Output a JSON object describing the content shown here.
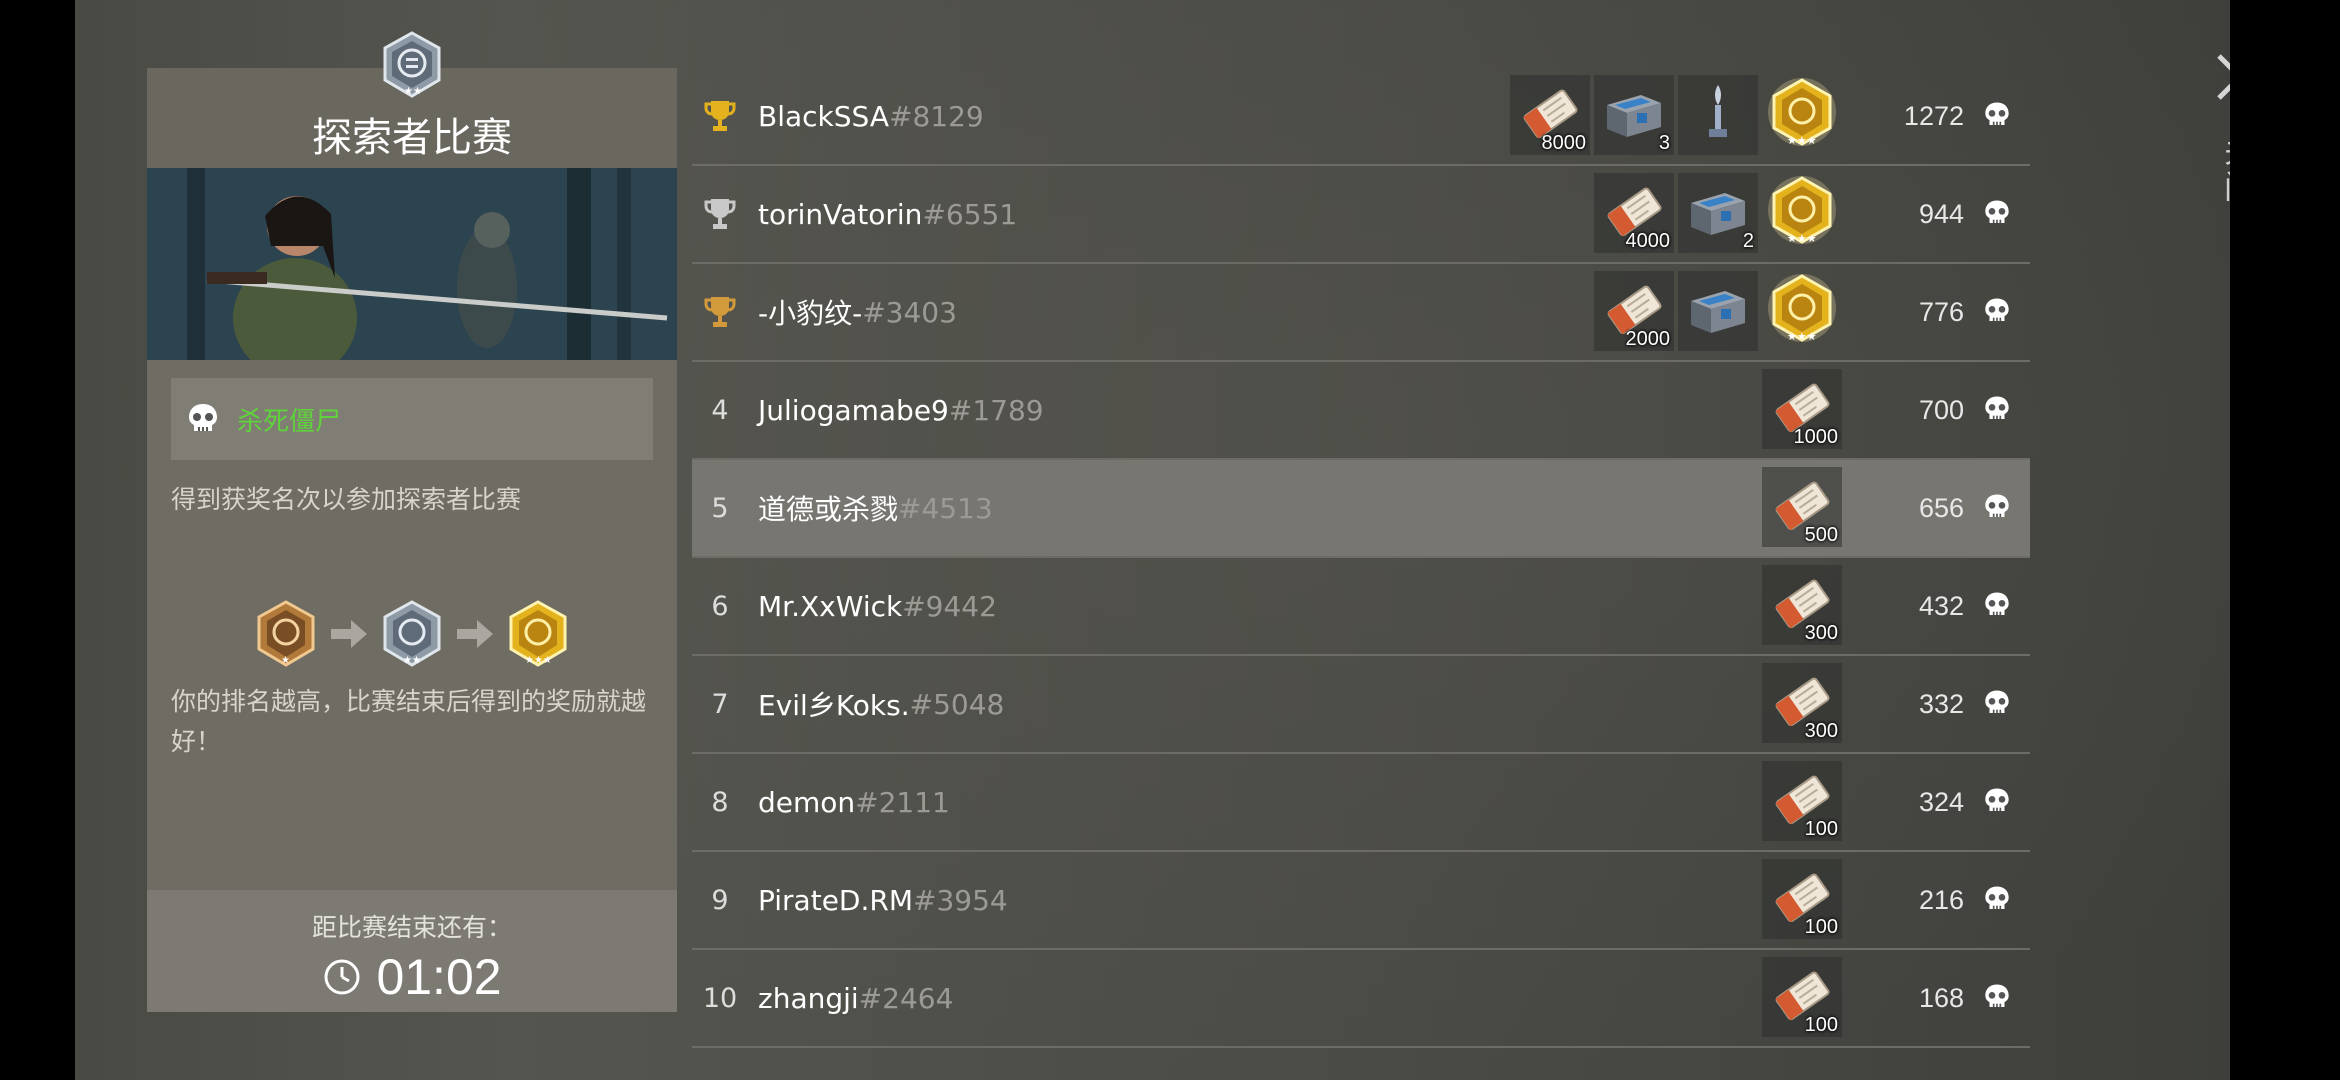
{
  "panel": {
    "title": "探索者比赛",
    "task": "杀死僵尸",
    "description": "得到获奖名次以参加探索者比赛",
    "reward_note": "你的排名越高，比赛结束后得到的奖励就越好！",
    "timer_label": "距比赛结束还有：",
    "timer_value": "01:02"
  },
  "close_label": "关闭",
  "colors": {
    "task_green": "#5fd33a",
    "gold": "#e4b21c",
    "silver": "#c8c8c8",
    "bronze": "#d29a3a"
  },
  "leaderboard": [
    {
      "rank": "1",
      "trophy": "gold",
      "name": "BlackSSA",
      "tag": "#8129",
      "score": "1272",
      "rewards": [
        {
          "icon": "ticket-icon",
          "qty": "8000"
        },
        {
          "icon": "chest-icon",
          "qty": "3"
        },
        {
          "icon": "statuette-icon",
          "qty": ""
        },
        {
          "icon": "gold-badge-icon",
          "qty": ""
        }
      ]
    },
    {
      "rank": "2",
      "trophy": "silver",
      "name": "torinVatorin",
      "tag": "#6551",
      "score": "944",
      "rewards": [
        {
          "icon": "ticket-icon",
          "qty": "4000"
        },
        {
          "icon": "chest-icon",
          "qty": "2"
        },
        {
          "icon": "gold-badge-icon",
          "qty": ""
        }
      ]
    },
    {
      "rank": "3",
      "trophy": "bronze",
      "name": "-小豹纹-",
      "tag": "#3403",
      "score": "776",
      "rewards": [
        {
          "icon": "ticket-icon",
          "qty": "2000"
        },
        {
          "icon": "chest-icon",
          "qty": ""
        },
        {
          "icon": "gold-badge-icon",
          "qty": ""
        }
      ]
    },
    {
      "rank": "4",
      "trophy": "",
      "name": "Juliogamabe9",
      "tag": "#1789",
      "score": "700",
      "rewards": [
        {
          "icon": "ticket-icon",
          "qty": "1000"
        }
      ]
    },
    {
      "rank": "5",
      "trophy": "",
      "name": "道德或杀戮",
      "tag": "#4513",
      "score": "656",
      "highlight": true,
      "rewards": [
        {
          "icon": "ticket-icon",
          "qty": "500"
        }
      ]
    },
    {
      "rank": "6",
      "trophy": "",
      "name": "Mr.XxWick",
      "tag": "#9442",
      "score": "432",
      "rewards": [
        {
          "icon": "ticket-icon",
          "qty": "300"
        }
      ]
    },
    {
      "rank": "7",
      "trophy": "",
      "name": "Evil乡Koks.",
      "tag": "#5048",
      "score": "332",
      "rewards": [
        {
          "icon": "ticket-icon",
          "qty": "300"
        }
      ]
    },
    {
      "rank": "8",
      "trophy": "",
      "name": "demon",
      "tag": "#2111",
      "score": "324",
      "rewards": [
        {
          "icon": "ticket-icon",
          "qty": "100"
        }
      ]
    },
    {
      "rank": "9",
      "trophy": "",
      "name": "PirateD.RM",
      "tag": "#3954",
      "score": "216",
      "rewards": [
        {
          "icon": "ticket-icon",
          "qty": "100"
        }
      ]
    },
    {
      "rank": "10",
      "trophy": "",
      "name": "zhangji",
      "tag": "#2464",
      "score": "168",
      "rewards": [
        {
          "icon": "ticket-icon",
          "qty": "100"
        }
      ]
    }
  ]
}
